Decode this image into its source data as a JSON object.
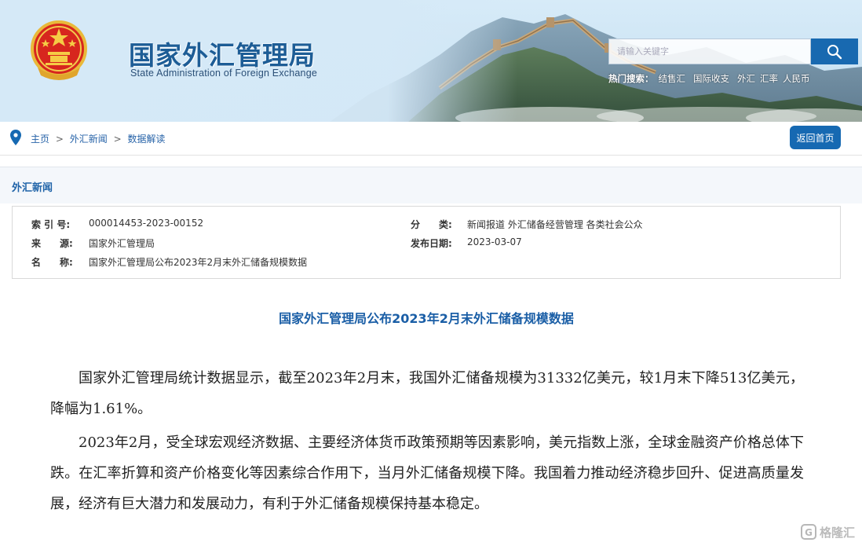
{
  "header": {
    "title": "国家外汇管理局",
    "subtitle": "State Administration of Foreign Exchange",
    "search_placeholder": "请输入关键字",
    "hot_label": "热门搜索：",
    "hot_links": [
      "结售汇",
      "国际收支",
      "外汇",
      "汇率",
      "人民币"
    ]
  },
  "breadcrumb": {
    "items": [
      "主页",
      "外汇新闻",
      "数据解读"
    ],
    "separator": ">"
  },
  "home_button": "返回首页",
  "section_title": "外汇新闻",
  "meta": {
    "index_label": "索 引 号:",
    "index_value": "000014453-2023-00152",
    "source_label": "来　　源:",
    "source_value": "国家外汇管理局",
    "name_label": "名　　称:",
    "name_value": "国家外汇管理局公布2023年2月末外汇储备规模数据",
    "category_label": "分　　类:",
    "category_value": "新闻报道  外汇储备经营管理  各类社会公众",
    "date_label": "发布日期:",
    "date_value": "2023-03-07"
  },
  "article": {
    "title": "国家外汇管理局公布2023年2月末外汇储备规模数据",
    "paragraphs": [
      "国家外汇管理局统计数据显示，截至2023年2月末，我国外汇储备规模为31332亿美元，较1月末下降513亿美元，降幅为1.61%。",
      "2023年2月，受全球宏观经济数据、主要经济体货币政策预期等因素影响，美元指数上涨，全球金融资产价格总体下跌。在汇率折算和资产价格变化等因素综合作用下，当月外汇储备规模下降。我国着力推动经济稳步回升、促进高质量发展，经济有巨大潜力和发展动力，有利于外汇储备规模保持基本稳定。"
    ]
  },
  "watermark": "格隆汇",
  "colors": {
    "brand_blue": "#1869b0",
    "title_blue": "#1a5ea6",
    "link_blue": "#2763a8"
  }
}
